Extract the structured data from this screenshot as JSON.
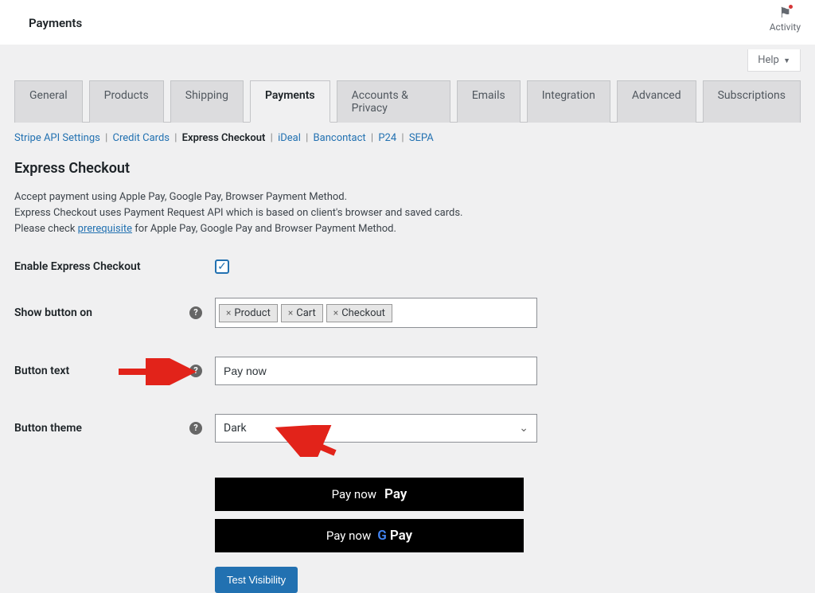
{
  "header": {
    "title": "Payments",
    "activity_label": "Activity"
  },
  "help_button": "Help",
  "tabs": [
    "General",
    "Products",
    "Shipping",
    "Payments",
    "Accounts & Privacy",
    "Emails",
    "Integration",
    "Advanced",
    "Subscriptions"
  ],
  "active_tab": "Payments",
  "subtabs": [
    "Stripe API Settings",
    "Credit Cards",
    "Express Checkout",
    "iDeal",
    "Bancontact",
    "P24",
    "SEPA"
  ],
  "active_subtab": "Express Checkout",
  "section": {
    "title": "Express Checkout",
    "desc_line1": "Accept payment using Apple Pay, Google Pay, Browser Payment Method.",
    "desc_line2a": "Express Checkout uses Payment Request API which is based on client's browser and saved cards.",
    "desc_line3a": "Please check ",
    "desc_link": "prerequisite",
    "desc_line3b": " for Apple Pay, Google Pay and Browser Payment Method."
  },
  "fields": {
    "enable": {
      "label": "Enable Express Checkout",
      "checked": true
    },
    "show_on": {
      "label": "Show button on",
      "tags": [
        "Product",
        "Cart",
        "Checkout"
      ]
    },
    "button_text": {
      "label": "Button text",
      "value": "Pay now"
    },
    "button_theme": {
      "label": "Button theme",
      "value": "Dark"
    }
  },
  "preview": {
    "apple_prefix": "Pay now",
    "apple_brand": "Pay",
    "google_prefix": "Pay now",
    "google_brand": "Pay",
    "test_button": "Test Visibility"
  }
}
